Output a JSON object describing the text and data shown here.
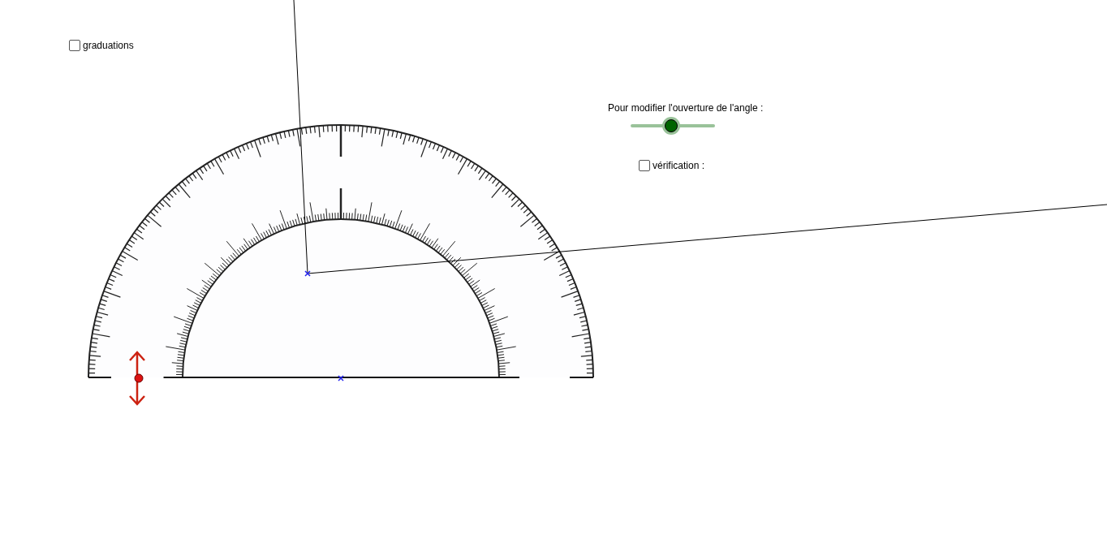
{
  "graduations": {
    "label": "graduations",
    "checked": false
  },
  "angle_slider": {
    "label": "Pour modifier l'ouverture de l'angle :",
    "level": 0.48
  },
  "verification": {
    "label": "vérification :",
    "checked": false
  }
}
